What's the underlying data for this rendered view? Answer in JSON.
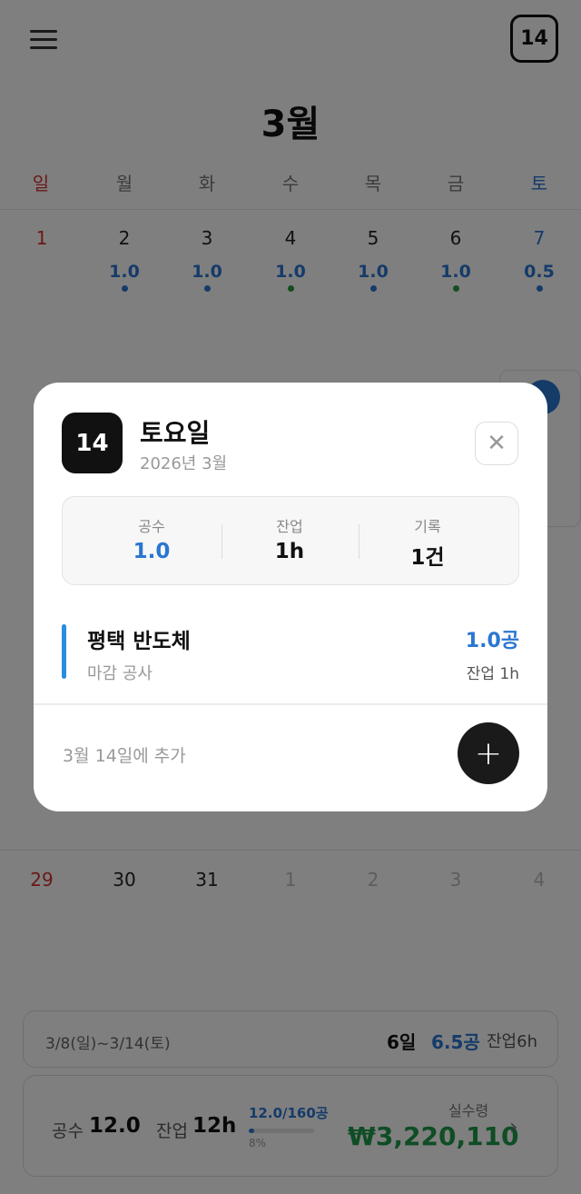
{
  "header": {
    "menu_icon": "hamburger-icon",
    "today_label": "14",
    "month_title": "3월"
  },
  "weekdays": [
    "일",
    "월",
    "화",
    "수",
    "목",
    "금",
    "토"
  ],
  "weeks": [
    [
      {
        "num": "1",
        "val": "",
        "dot": "",
        "muted": false
      },
      {
        "num": "2",
        "val": "1.0",
        "dot": "#2a76d2",
        "muted": false
      },
      {
        "num": "3",
        "val": "1.0",
        "dot": "#2a76d2",
        "muted": false
      },
      {
        "num": "4",
        "val": "1.0",
        "dot": "#2a9a40",
        "muted": false
      },
      {
        "num": "5",
        "val": "1.0",
        "dot": "#2a76d2",
        "muted": false
      },
      {
        "num": "6",
        "val": "1.0",
        "dot": "#2a9a40",
        "muted": false
      },
      {
        "num": "7",
        "val": "0.5",
        "dot": "#2a76d2",
        "muted": false
      }
    ],
    [
      {
        "num": "29",
        "val": "",
        "dot": "",
        "muted": false
      },
      {
        "num": "30",
        "val": "",
        "dot": "",
        "muted": false
      },
      {
        "num": "31",
        "val": "",
        "dot": "",
        "muted": false
      },
      {
        "num": "1",
        "val": "",
        "dot": "",
        "muted": true
      },
      {
        "num": "2",
        "val": "",
        "dot": "",
        "muted": true
      },
      {
        "num": "3",
        "val": "",
        "dot": "",
        "muted": true
      },
      {
        "num": "4",
        "val": "",
        "dot": "",
        "muted": true
      }
    ]
  ],
  "week_summary": {
    "range": "3/8(일)~3/14(토)",
    "days": "6일",
    "gong": "6.5공",
    "overtime": "잔업6h"
  },
  "month_summary": {
    "gong_label": "공수",
    "gong_value": "12.0",
    "ot_label": "잔업",
    "ot_value": "12h",
    "progress_text": "12.0/160공",
    "progress_fraction": 0.08,
    "progress_pct": "8%",
    "net_label": "실수령",
    "net_amount": "₩3,220,110"
  },
  "modal": {
    "date": "14",
    "weekday": "토요일",
    "year_month": "2026년 3월",
    "close_icon": "close-icon",
    "stats": [
      {
        "label": "공수",
        "value": "1.0",
        "color": "#2a76d2"
      },
      {
        "label": "잔업",
        "value": "1h",
        "color": "#111111"
      },
      {
        "label": "기록",
        "value": "1건",
        "color": "#111111"
      }
    ],
    "record": {
      "site": "평택 반도체",
      "task": "마감 공사",
      "gong": "1.0공",
      "overtime": "잔업 1h",
      "color": "#2a8ce0"
    },
    "add_text": "3월 14일에 추가",
    "add_icon": "plus-icon"
  }
}
